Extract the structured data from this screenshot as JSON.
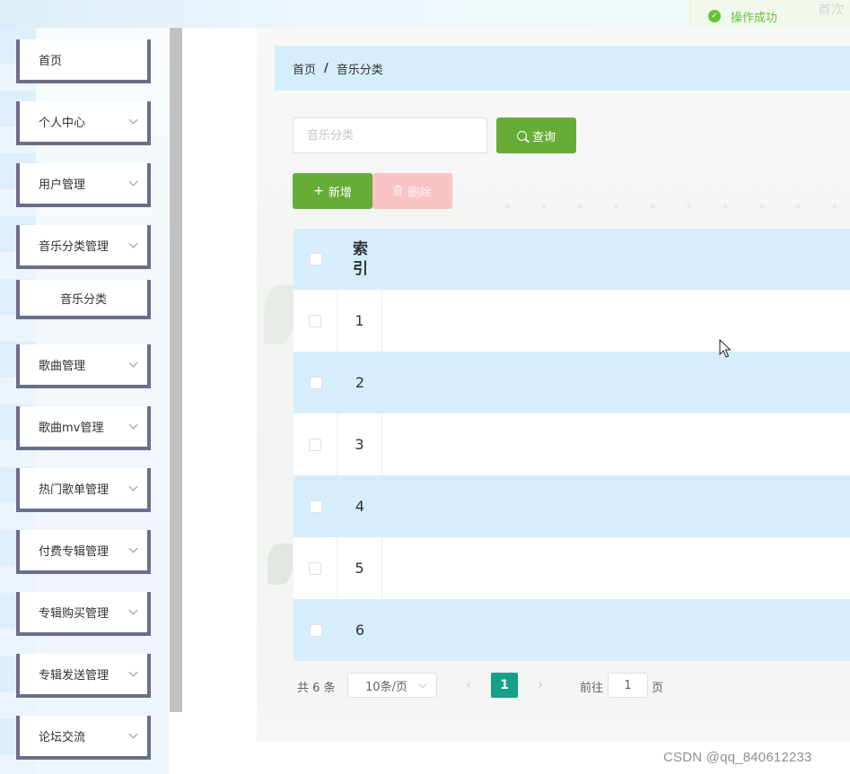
{
  "toast": {
    "message": "操作成功",
    "ghost_text": "首次"
  },
  "sidebar": {
    "items": [
      {
        "label": "首页",
        "expandable": false
      },
      {
        "label": "个人中心",
        "expandable": true
      },
      {
        "label": "用户管理",
        "expandable": true
      },
      {
        "label": "音乐分类管理",
        "expandable": true
      },
      {
        "label": "音乐分类",
        "expandable": false,
        "submenu": true
      },
      {
        "label": "歌曲管理",
        "expandable": true
      },
      {
        "label": "歌曲mv管理",
        "expandable": true
      },
      {
        "label": "热门歌单管理",
        "expandable": true
      },
      {
        "label": "付费专辑管理",
        "expandable": true
      },
      {
        "label": "专辑购买管理",
        "expandable": true
      },
      {
        "label": "专辑发送管理",
        "expandable": true
      },
      {
        "label": "论坛交流",
        "expandable": true
      }
    ]
  },
  "breadcrumb": {
    "home": "首页",
    "separator": "/",
    "current": "音乐分类"
  },
  "search": {
    "placeholder": "音乐分类",
    "value": "",
    "query_label": "查询"
  },
  "actions": {
    "add_label": "新增",
    "delete_label": "删除"
  },
  "table": {
    "index_header": "索引",
    "rows": [
      {
        "index": "1"
      },
      {
        "index": "2"
      },
      {
        "index": "3"
      },
      {
        "index": "4"
      },
      {
        "index": "5"
      },
      {
        "index": "6"
      }
    ]
  },
  "pagination": {
    "total": "共 6 条",
    "page_size": "10条/页",
    "prev": "‹",
    "current_page": "1",
    "next": "›",
    "goto_label": "前往",
    "goto_value": "1",
    "page_unit": "页"
  },
  "watermark": "CSDN @qq_840612233",
  "colors": {
    "primary_green": "#67ad35",
    "danger_light": "#fbc4c4",
    "row_highlight": "#d6eefc",
    "menu_border": "#6b6e8a",
    "active_page": "#16a085",
    "success": "#67c23a"
  }
}
